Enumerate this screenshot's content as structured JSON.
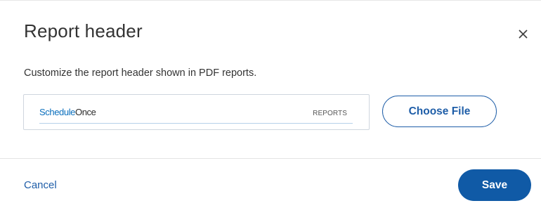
{
  "dialog": {
    "title": "Report header",
    "close_icon": "close-icon",
    "description": "Customize the report header shown in PDF reports.",
    "preview": {
      "logo_text_brand": "Schedule",
      "logo_text_once": "Once",
      "tag_text": "REPORTS"
    },
    "choose_file_label": "Choose File",
    "footer": {
      "cancel_label": "Cancel",
      "save_label": "Save"
    }
  },
  "colors": {
    "accent": "#1f5ea8",
    "primary_button": "#105aa6",
    "text": "#333333",
    "logo_blue": "#0a6fbd"
  }
}
